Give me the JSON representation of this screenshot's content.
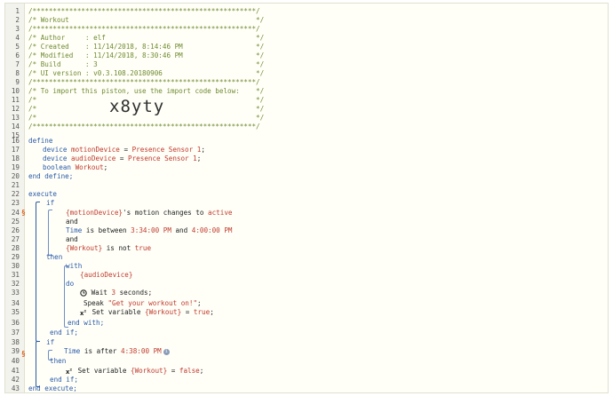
{
  "header": [
    "/*******************************************************/",
    "/* Workout                                              */",
    "/*******************************************************/",
    "/* Author     : elf                                     */",
    "/* Created    : 11/14/2018, 8:14:46 PM                  */",
    "/* Modified   : 11/14/2018, 8:30:46 PM                  */",
    "/* Build      : 3                                       */",
    "/* UI version : v0.3.108.20180906                       */",
    "/*******************************************************/",
    "/* To import this piston, use the import code below:    */",
    "/*                                                      */",
    "/*                                                      */",
    "/*                                                      */",
    "/*******************************************************/"
  ],
  "import_code": "x8yty",
  "lines": {
    "l16": "define",
    "l17_kw": "device",
    "l17_var": "motionDevice",
    "l17_eq": " = ",
    "l17_val": "Presence Sensor 1",
    "l18_kw": "device",
    "l18_var": "audioDevice",
    "l18_eq": " = ",
    "l18_val": "Presence Sensor 1",
    "l19_kw": "boolean",
    "l19_var": "Workout",
    "l20": "end define;",
    "l22": "execute",
    "l23": "if",
    "l24_var": "{motionDevice}",
    "l24_txt": "'s motion changes to ",
    "l24_val": "active",
    "l25": "and",
    "l26_kw": "Time",
    "l26_txt": " is between ",
    "l26_v1": "3:34:00 PM",
    "l26_and": " and ",
    "l26_v2": "4:00:00 PM",
    "l27": "and",
    "l28_var": "{Workout}",
    "l28_txt": " is not ",
    "l28_val": "true",
    "l29": "then",
    "l30": "with",
    "l31_var": "{audioDevice}",
    "l32": "do",
    "l33_txt": "Wait ",
    "l33_num": "3",
    "l33_txt2": " seconds;",
    "l34_txt": "Speak ",
    "l34_str": "\"Get your workout on!\"",
    "l35_txt": "Set variable ",
    "l35_var": "{Workout}",
    "l35_eq": " = ",
    "l35_val": "true",
    "l36": "end with;",
    "l37": "end if;",
    "l38": "if",
    "l39_kw": "Time",
    "l39_txt": " is after ",
    "l39_val": "4:38:00 PM",
    "l40": "then",
    "l41_txt": "Set variable ",
    "l41_var": "{Workout}",
    "l41_eq": " = ",
    "l41_val": "false",
    "l42": "end if;",
    "l43": "end execute;"
  },
  "line_numbers": [
    "1",
    "2",
    "3",
    "4",
    "5",
    "6",
    "7",
    "8",
    "9",
    "10",
    "11",
    "12",
    "13",
    "14",
    "15",
    "16",
    "17",
    "18",
    "19",
    "20",
    "21",
    "22",
    "23",
    "24",
    "25",
    "26",
    "27",
    "28",
    "29",
    "30",
    "31",
    "32",
    "33",
    "34",
    "35",
    "36",
    "37",
    "38",
    "39",
    "40",
    "41",
    "42",
    "43"
  ],
  "markers": {
    "m24": "§",
    "m39": "§"
  },
  "colors": {
    "comment": "#6f8a2f",
    "keyword": "#2a5aa8",
    "value": "#c0392b",
    "marker": "#d9641c"
  }
}
